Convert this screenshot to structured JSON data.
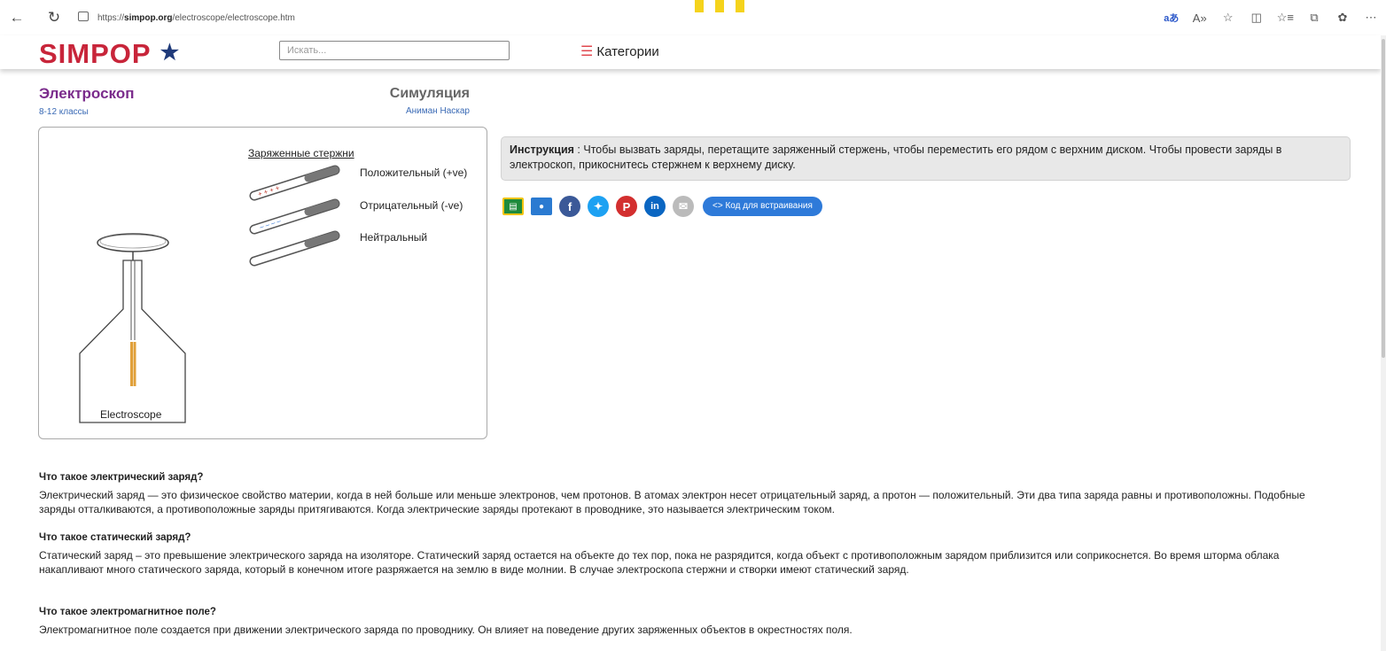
{
  "browser": {
    "url_prefix": "https://",
    "url_host": "simpop.org",
    "url_path": "/electroscope/electroscope.htm"
  },
  "header": {
    "logo": "SIMPOP",
    "search_placeholder": "Искать...",
    "categories": "Категории"
  },
  "page": {
    "title": "Электроскоп",
    "grades": "8-12 классы",
    "sim_label": "Симуляция",
    "author": "Аниман Наскар"
  },
  "simulation": {
    "rods_title": "Заряженные стержни",
    "rods": [
      {
        "label": "Положительный (+ve)",
        "marks": "+ + + +"
      },
      {
        "label": "Отрицательный (-ve)",
        "marks": "– – – –"
      },
      {
        "label": "Нейтральный",
        "marks": ""
      }
    ],
    "electroscope_label": "Electroscope"
  },
  "instruction": {
    "bold": "Инструкция",
    "text": " : Чтобы вызвать заряды, перетащите заряженный стержень, чтобы переместить его рядом с верхним диском. Чтобы провести заряды в электроскоп, прикоснитесь стержнем к верхнему диску."
  },
  "share": {
    "embed_label": "Код для встраивания"
  },
  "articles": [
    {
      "heading": "Что такое электрический заряд?",
      "text": "Электрический заряд — это физическое свойство материи, когда в ней больше или меньше электронов, чем протонов. В атомах электрон несет отрицательный заряд, а протон — положительный. Эти два типа заряда равны и противоположны. Подобные заряды отталкиваются, а противоположные заряды притягиваются. Когда электрические заряды протекают в проводнике, это называется электрическим током."
    },
    {
      "heading": "Что такое статический заряд?",
      "text": "Статический заряд – это превышение электрического заряда на изоляторе. Статический заряд остается на объекте до тех пор, пока не разрядится, когда объект с противоположным зарядом приблизится или соприкоснется. Во время шторма облака накапливают много статического заряда, который в конечном итоге разряжается на землю в виде молнии. В случае электроскопа стержни и створки имеют статический заряд."
    },
    {
      "heading": "Что такое электромагнитное поле?",
      "text": "Электромагнитное поле создается при движении электрического заряда по проводнику. Он влияет на поведение других заряженных объектов в окрестностях поля."
    }
  ],
  "colors": {
    "brand_red": "#c8253a",
    "title_purple": "#7b2c8c",
    "link_blue": "#3a6ab5",
    "leaf_orange": "#e0a03a"
  }
}
